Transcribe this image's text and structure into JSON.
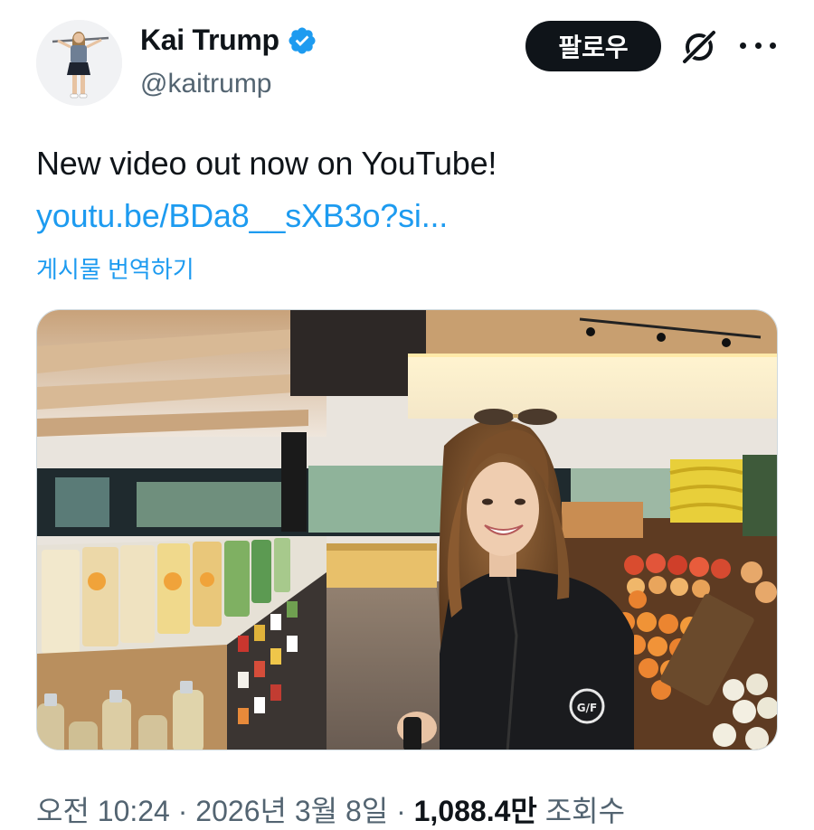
{
  "author": {
    "display_name": "Kai Trump",
    "handle": "@kaitrump",
    "verified": true,
    "avatar_icon": "avatar-golfer-photo"
  },
  "header": {
    "follow_label": "팔로우",
    "grok_icon": "grok-icon",
    "more_icon": "more-icon"
  },
  "tweet": {
    "text": "New video out now on YouTube!",
    "link": "youtu.be/BDa8__sXB3o?si...",
    "translate_label": "게시물 번역하기"
  },
  "media": {
    "type": "video-thumbnail",
    "jacket_logo": "G/FORE"
  },
  "meta": {
    "time": "오전 10:24",
    "sep1": " · ",
    "date": "2026년 3월 8일",
    "sep2": " · ",
    "views": "1,088.4만",
    "views_suffix": " 조회수"
  },
  "colors": {
    "accent": "#1d9bf0",
    "text": "#0f1419",
    "muted": "#536471",
    "button_bg": "#0f1419"
  }
}
